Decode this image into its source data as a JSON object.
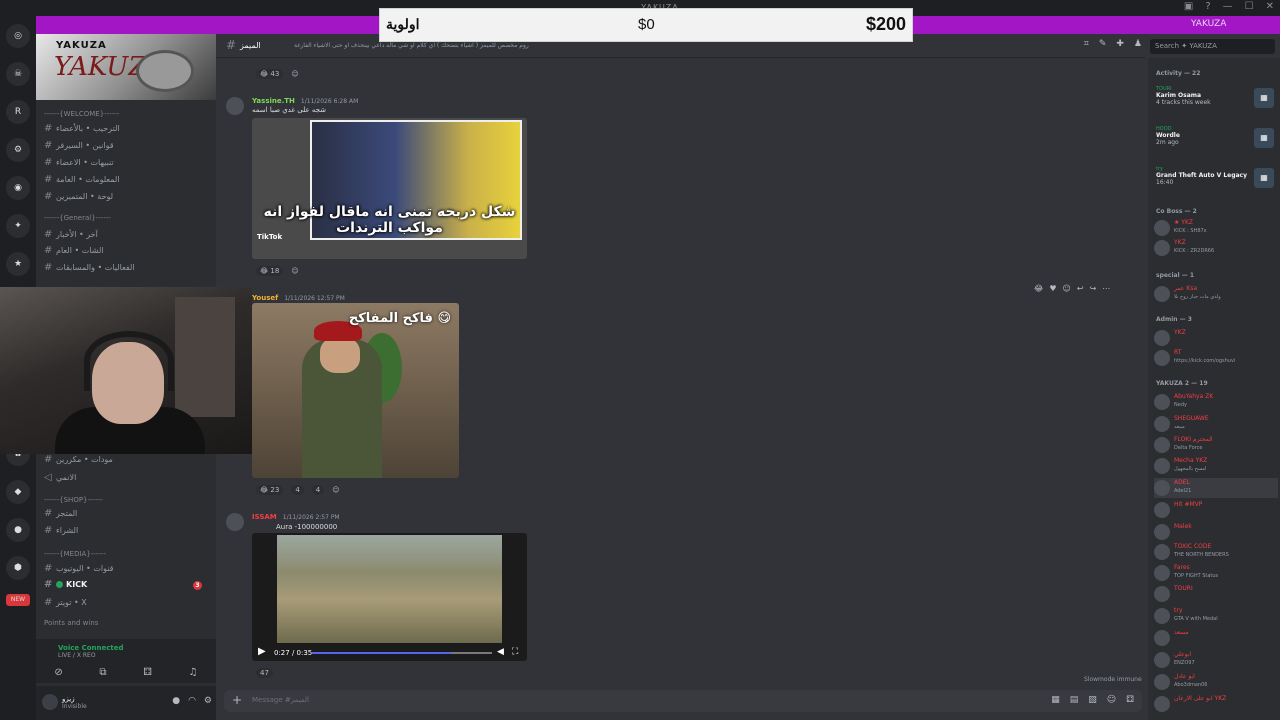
{
  "window": {
    "title": "YAKUZA"
  },
  "donation": {
    "label": "اولوية",
    "current": "$0",
    "goal": "$200"
  },
  "accent": {
    "title": "YAKUZA"
  },
  "colors": {
    "accent_bar": "#a316c6",
    "background": "#313338",
    "sidebar": "#2b2d31",
    "online": "#23a55a",
    "mention": "#da373c"
  },
  "servers": [
    {
      "icon": "discord-icon",
      "label": "◎"
    },
    {
      "icon": "server-icon",
      "label": "☠"
    },
    {
      "icon": "server-icon",
      "label": "R"
    },
    {
      "icon": "server-icon",
      "label": "⚙"
    },
    {
      "icon": "server-icon",
      "label": "◉"
    },
    {
      "icon": "server-icon",
      "label": "✦"
    },
    {
      "icon": "server-icon",
      "label": "★"
    },
    {
      "icon": "server-icon",
      "label": "♞"
    },
    {
      "icon": "server-icon",
      "label": "▲"
    },
    {
      "icon": "server-icon",
      "label": "♛"
    },
    {
      "icon": "server-icon",
      "label": "H"
    },
    {
      "icon": "server-icon",
      "label": "✿"
    },
    {
      "icon": "server-icon",
      "label": "◆"
    },
    {
      "icon": "server-icon",
      "label": "●"
    },
    {
      "icon": "server-icon",
      "label": "⬢"
    },
    {
      "icon": "new-badge",
      "label": "NEW"
    }
  ],
  "sidebar": {
    "server_name": "YAKUZA",
    "banner_text": "YAKUZA",
    "channels": [
      {
        "label": "------{WELCOME}------",
        "type": "category"
      },
      {
        "label": "الترحيب • بالأعضاء",
        "type": "text"
      },
      {
        "label": "قوانين • السيرفر",
        "type": "text"
      },
      {
        "label": "تنبيهات • الاعضاء",
        "type": "text"
      },
      {
        "label": "المعلومات • العامة",
        "type": "text"
      },
      {
        "label": "لوحة • المتميزين",
        "type": "text"
      },
      {
        "label": "------{General}------",
        "type": "category"
      },
      {
        "label": "آخر • الأخبار",
        "type": "text"
      },
      {
        "label": "الشات • العام",
        "type": "text"
      },
      {
        "label": "الفعاليات • والمسابقات",
        "type": "text"
      },
      {
        "label": "مودات • مكررين",
        "type": "text"
      },
      {
        "label": "الانمي",
        "type": "voice"
      },
      {
        "label": "------{SHOP}------",
        "type": "category"
      },
      {
        "label": "المتجر",
        "type": "text"
      },
      {
        "label": "الشراء",
        "type": "text"
      },
      {
        "label": "------{MEDIA}------",
        "type": "category"
      },
      {
        "label": "قنوات • اليوتيوب",
        "type": "text"
      },
      {
        "label": "KICK",
        "type": "active"
      },
      {
        "label": "تويتر • X",
        "type": "text"
      },
      {
        "label": "Points and wins",
        "type": "category"
      }
    ],
    "kick_badge": "3",
    "voice": {
      "status": "Voice Connected",
      "sub": "LIVE / X REO"
    },
    "user": {
      "name": "زيزو",
      "status": "Invisible"
    }
  },
  "channel": {
    "name": "الميمز",
    "topic": "روم مخصص للميمز ( اشياء بتضحك ) اي كلام او شي ماله داعي بينحذف او حتى الاشياء الفارغة"
  },
  "search": {
    "placeholder": "Search ✦ YAKUZA"
  },
  "messages": [
    {
      "author": "",
      "time": "",
      "text": "",
      "reactions": [
        "😂 43"
      ],
      "media": ""
    },
    {
      "author": "Yassine.TH",
      "time": "1/11/2026 6:28 AM",
      "text": "شجه على غدي صبا اسمه",
      "media_caption": "شكل دربحه تمنى انه ماقال لفواز انه مواكب الترندات",
      "media_tag": "TikTok",
      "reactions": [
        "😂 18"
      ]
    },
    {
      "author": "Yousef",
      "time": "1/11/2026 12:57 PM",
      "text": "",
      "media_caption": "فاكح المفاكح 😋",
      "reactions": [
        "😂 23",
        "4",
        "4"
      ]
    },
    {
      "author": "ISSAM",
      "time": "1/11/2026 2:57 PM",
      "text": "Aura -100000000",
      "video_time": "0:27 / 0:35",
      "video_progress": 0.77,
      "reactions": [
        "47"
      ]
    }
  ],
  "composer": {
    "placeholder": "Message #الميمز",
    "slowmode": "Slowmode immune"
  },
  "right": {
    "activity_header": "Activity — 22",
    "activities": [
      {
        "name": "Karim Osama",
        "status": "TOURI",
        "game": "4 tracks this week",
        "icon": "spotify-icon"
      },
      {
        "name": "Wordle",
        "status": "HOOD",
        "game": "2m ago",
        "icon": "grid-icon"
      },
      {
        "name": "Grand Theft Auto V Legacy",
        "status": "try",
        "game": "16:40",
        "icon": "gta-icon"
      }
    ],
    "sections": [
      {
        "label": "Co Boss — 2"
      },
      {
        "label": "special — 1"
      },
      {
        "label": "Admin — 3"
      },
      {
        "label": "YAKUZA 2 — 19"
      }
    ],
    "members": [
      {
        "name": "★ YKZ",
        "status": "KICK : SH87x"
      },
      {
        "name": "YKZ",
        "status": "KICK : ZR2DR66"
      },
      {
        "name": "عمر Ksa",
        "status": "ولدي مات جبار روح بلا"
      },
      {
        "name": "YKZ",
        "status": ""
      },
      {
        "name": "RT",
        "status": "https://kick.com/ogshuvi"
      },
      {
        "name": "AbuYahya ZK",
        "status": "Nedy"
      },
      {
        "name": "SHEGUAWE",
        "status": "مبيعه"
      },
      {
        "name": "FLOKI المحترم",
        "status": "Delta Force"
      },
      {
        "name": "Mecha YKZ",
        "status": "امسح بالمجهول"
      },
      {
        "name": "ADEL",
        "status": "Adel21"
      },
      {
        "name": "Hit #MVP",
        "status": ""
      },
      {
        "name": "Malek",
        "status": ""
      },
      {
        "name": "TOXIC CODE",
        "status": "THE NORTH BENDERS"
      },
      {
        "name": "Fares",
        "status": "TOP FIGHT Status"
      },
      {
        "name": "TOURI",
        "status": ""
      },
      {
        "name": "try",
        "status": "GTA V with Medal"
      },
      {
        "name": "مسعد",
        "status": ""
      },
      {
        "name": "ابوعلي",
        "status": "ENZO97"
      },
      {
        "name": "ابو عادل",
        "status": "Abo3dman06"
      },
      {
        "name": "ابو على الارعان YKZ",
        "status": ""
      }
    ]
  }
}
